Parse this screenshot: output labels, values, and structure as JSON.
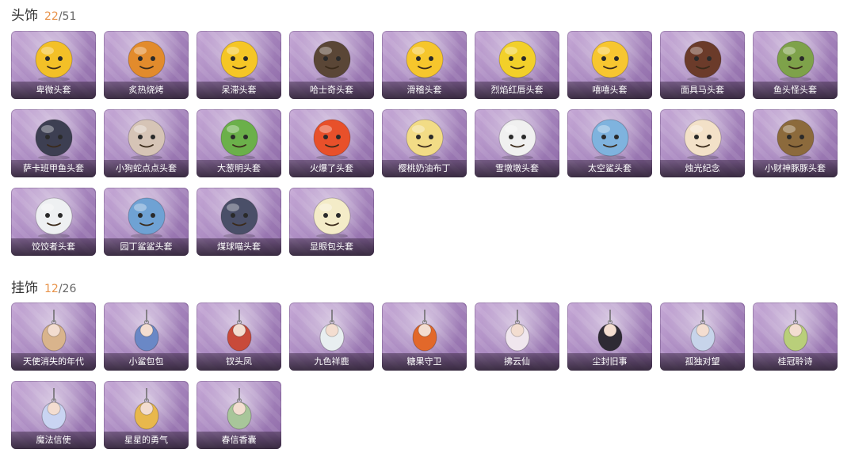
{
  "headwear": {
    "title": "头饰",
    "owned": "22",
    "separator": "/",
    "total": "51",
    "items": [
      {
        "label": "卑微头套",
        "icon": "yellow-face-worried-icon",
        "color": "#f3c027"
      },
      {
        "label": "炙热烧烤",
        "icon": "orange-grill-face-icon",
        "color": "#e28b2c"
      },
      {
        "label": "呆滞头套",
        "icon": "yellow-face-dazed-icon",
        "color": "#f5c626"
      },
      {
        "label": "哈士奇头套",
        "icon": "husky-sunglasses-icon",
        "color": "#5a4636"
      },
      {
        "label": "滑稽头套",
        "icon": "yellow-face-grin-icon",
        "color": "#f6c62c"
      },
      {
        "label": "烈焰红唇头套",
        "icon": "pikachu-sunglasses-icon",
        "color": "#f2d02a"
      },
      {
        "label": "嘻嘻头套",
        "icon": "yellow-face-laugh-icon",
        "color": "#f7c630"
      },
      {
        "label": "面具马头套",
        "icon": "horse-mask-icon",
        "color": "#6b3b2a"
      },
      {
        "label": "鱼头怪头套",
        "icon": "green-fish-head-icon",
        "color": "#7ea24a"
      },
      {
        "label": "萨卡班甲鱼头套",
        "icon": "sacabambaspis-icon",
        "color": "#3d3f52"
      },
      {
        "label": "小狗蛇点点头套",
        "icon": "snake-dots-icon",
        "color": "#d6c4b6"
      },
      {
        "label": "大葱明头套",
        "icon": "green-onion-icon",
        "color": "#6bb04a"
      },
      {
        "label": "火爆了头套",
        "icon": "fire-sprite-icon",
        "color": "#e8502a"
      },
      {
        "label": "樱桃奶油布丁",
        "icon": "pudding-icon",
        "color": "#f2dc86"
      },
      {
        "label": "雪墩墩头套",
        "icon": "snowman-deer-icon",
        "color": "#f0f0f0"
      },
      {
        "label": "太空鲨头套",
        "icon": "space-shark-icon",
        "color": "#7fb3de"
      },
      {
        "label": "烛光纪念",
        "icon": "candle-icon",
        "color": "#f3e1c8"
      },
      {
        "label": "小财神豚豚头套",
        "icon": "capybara-icon",
        "color": "#8c6a3c"
      },
      {
        "label": "饺饺者头套",
        "icon": "dumpling-icon",
        "color": "#eef0f2"
      },
      {
        "label": "园丁鲨鲨头套",
        "icon": "gardener-shark-icon",
        "color": "#6fa2d4"
      },
      {
        "label": "煤球喵头套",
        "icon": "black-cat-icon",
        "color": "#4a4f68"
      },
      {
        "label": "显眼包头套",
        "icon": "bulb-head-icon",
        "color": "#f4ecc8"
      }
    ]
  },
  "accessories": {
    "title": "挂饰",
    "owned": "12",
    "separator": "/",
    "total": "26",
    "items": [
      {
        "label": "天使消失的年代",
        "icon": "angel-figure-icon",
        "color": "#d9b48c"
      },
      {
        "label": "小鲨包包",
        "icon": "shark-bag-icon",
        "color": "#6a88c6"
      },
      {
        "label": "钗头凤",
        "icon": "phoenix-hairpin-icon",
        "color": "#c84a3a"
      },
      {
        "label": "九色祥鹿",
        "icon": "deer-charm-icon",
        "color": "#e8eef0"
      },
      {
        "label": "糖果守卫",
        "icon": "pumpkin-charm-icon",
        "color": "#e2682a"
      },
      {
        "label": "拂云仙",
        "icon": "cloud-fairy-icon",
        "color": "#f0e6ee"
      },
      {
        "label": "尘封旧事",
        "icon": "prince-figure-icon",
        "color": "#2e2a34"
      },
      {
        "label": "孤独对望",
        "icon": "lonely-figure-icon",
        "color": "#c7d4ea"
      },
      {
        "label": "桂冠聆诗",
        "icon": "laurel-figure-icon",
        "color": "#b9cf7a"
      },
      {
        "label": "魔法信使",
        "icon": "mouse-messenger-icon",
        "color": "#c9d4f2"
      },
      {
        "label": "星星的勇气",
        "icon": "star-lion-icon",
        "color": "#e8b84c"
      },
      {
        "label": "春信香囊",
        "icon": "sachet-icon",
        "color": "#a8c69a"
      }
    ]
  }
}
